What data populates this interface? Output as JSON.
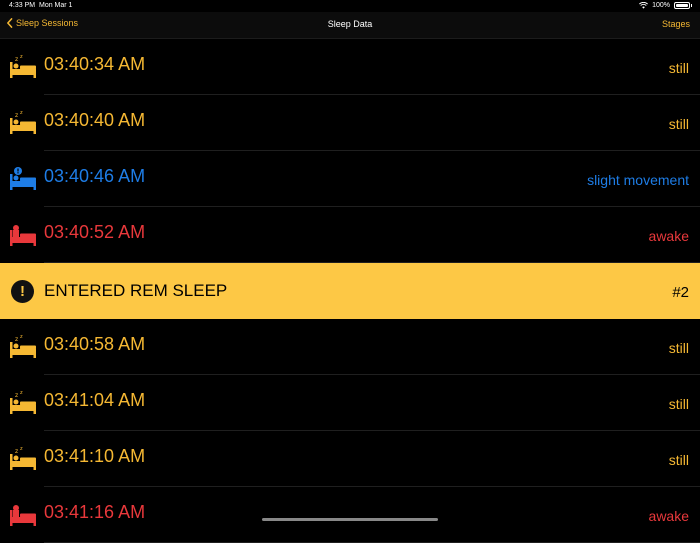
{
  "status_bar": {
    "time": "4:33 PM",
    "date": "Mon Mar 1",
    "battery": "100%"
  },
  "nav": {
    "back_label": "Sleep Sessions",
    "title": "Sleep Data",
    "right_label": "Stages"
  },
  "colors": {
    "still": "#f5b833",
    "slight_movement": "#1e7de6",
    "awake": "#e8383b",
    "banner": "#fdc845"
  },
  "rows": [
    {
      "kind": "entry",
      "icon": "sleeping-bed-icon",
      "time": "03:40:34 AM",
      "state": "still",
      "color": "#f5b833"
    },
    {
      "kind": "entry",
      "icon": "sleeping-bed-icon",
      "time": "03:40:40 AM",
      "state": "still",
      "color": "#f5b833"
    },
    {
      "kind": "entry",
      "icon": "movement-bed-icon",
      "time": "03:40:46 AM",
      "state": "slight movement",
      "color": "#1e7de6"
    },
    {
      "kind": "entry",
      "icon": "awake-bed-icon",
      "time": "03:40:52 AM",
      "state": "awake",
      "color": "#e8383b"
    },
    {
      "kind": "banner",
      "icon": "exclamation-icon",
      "text": "ENTERED REM SLEEP",
      "count": "#2"
    },
    {
      "kind": "entry",
      "icon": "sleeping-bed-icon",
      "time": "03:40:58 AM",
      "state": "still",
      "color": "#f5b833"
    },
    {
      "kind": "entry",
      "icon": "sleeping-bed-icon",
      "time": "03:41:04 AM",
      "state": "still",
      "color": "#f5b833"
    },
    {
      "kind": "entry",
      "icon": "sleeping-bed-icon",
      "time": "03:41:10 AM",
      "state": "still",
      "color": "#f5b833"
    },
    {
      "kind": "entry",
      "icon": "awake-bed-icon",
      "time": "03:41:16 AM",
      "state": "awake",
      "color": "#e8383b"
    }
  ]
}
